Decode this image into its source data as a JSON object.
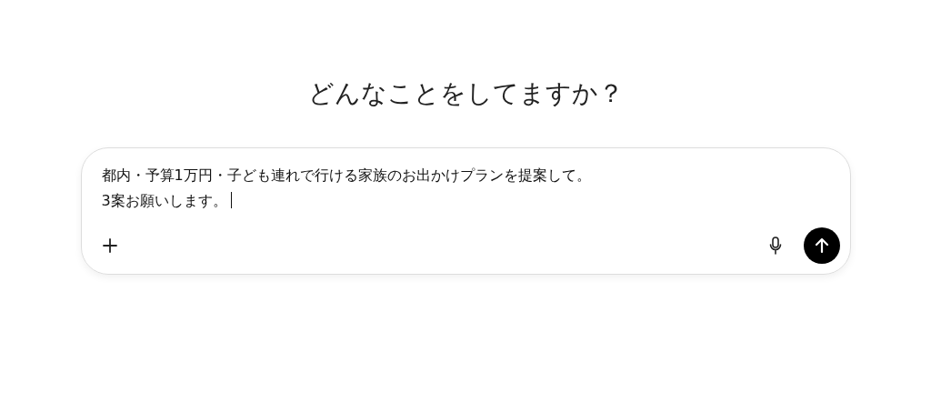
{
  "heading": "どんなことをしてますか？",
  "composer": {
    "value": "都内・予算1万円・子ども連れで行ける家族のお出かけプランを提案して。\n3案お願いします。",
    "caret": true
  }
}
